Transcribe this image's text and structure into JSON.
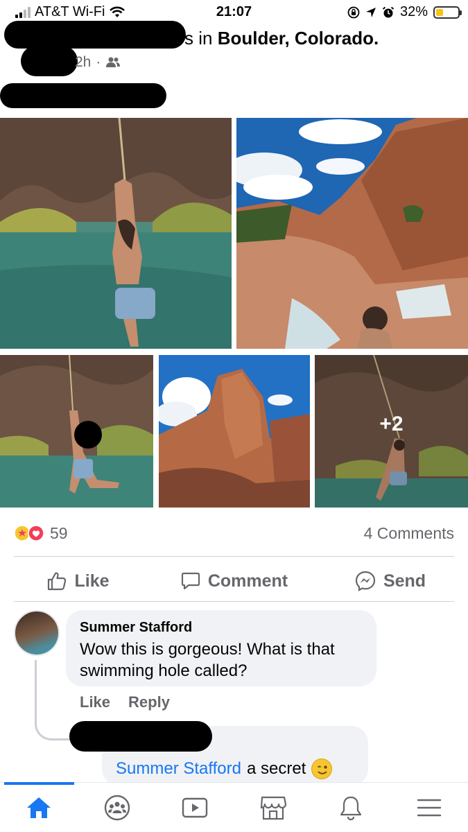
{
  "status_bar": {
    "carrier": "AT&T Wi-Fi",
    "time": "21:07",
    "battery_percent": "32%",
    "battery_level": 0.32,
    "icons": [
      "wifi-icon",
      "screen-lock-icon",
      "location-arrow-icon",
      "alarm-icon",
      "battery-icon"
    ]
  },
  "post": {
    "location_prefix": "s in ",
    "location": "Boulder, Colorado.",
    "time_ago": "2h",
    "separator": "·",
    "audience_icon": "friends-icon",
    "photos_more": "+2"
  },
  "engagement": {
    "reaction_count": "59",
    "comments_count": "4 Comments",
    "reaction_icons": [
      "care-reaction-icon",
      "love-reaction-icon"
    ]
  },
  "actions": {
    "like": "Like",
    "comment": "Comment",
    "send": "Send"
  },
  "comments": [
    {
      "author": "Summer Stafford",
      "text": "Wow this is gorgeous! What is that swimming hole called?",
      "like_label": "Like",
      "reply_label": "Reply"
    }
  ],
  "reply": {
    "mention": "Summer Stafford",
    "text": "a secret",
    "emoji": "wink-emoji"
  },
  "tabbar": {
    "items": [
      "home-icon",
      "groups-icon",
      "watch-icon",
      "marketplace-icon",
      "notifications-icon",
      "menu-icon"
    ],
    "active": "home-icon"
  },
  "colors": {
    "accent": "#1877f2",
    "secondary_text": "#65676b",
    "bubble": "#f0f2f5",
    "love": "#f33e58"
  }
}
